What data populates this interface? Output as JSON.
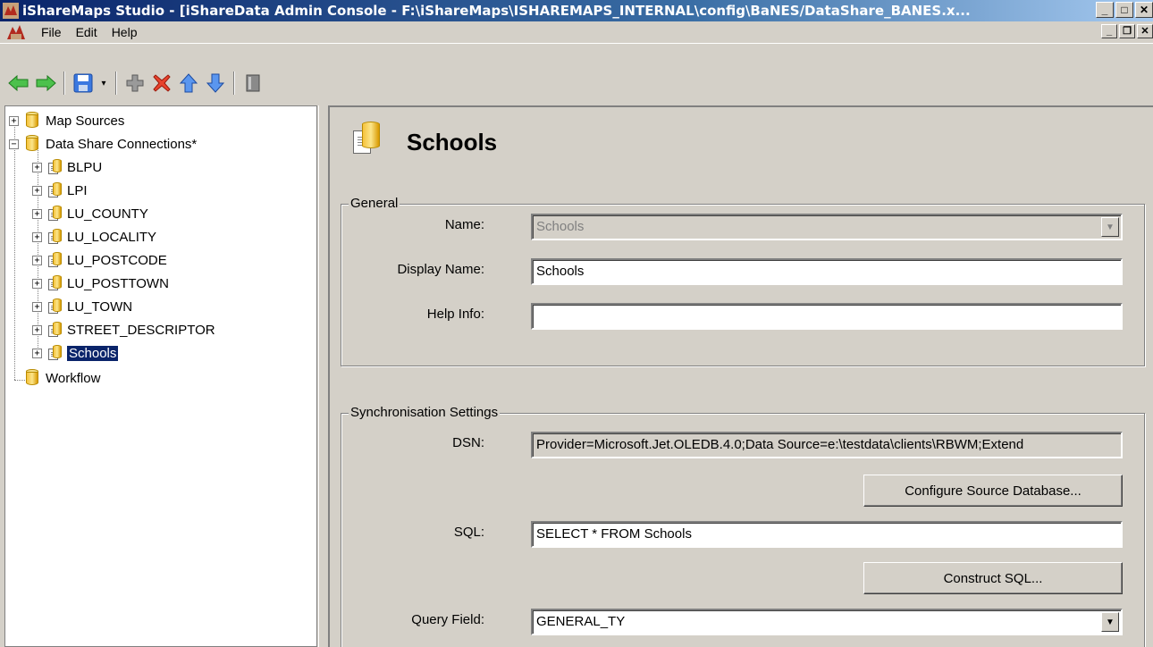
{
  "window": {
    "title": "iShareMaps Studio - [iShareData Admin Console - F:\\iShareMaps\\ISHAREMAPS_INTERNAL\\config\\BaNES/DataShare_BANES.x...",
    "minimize": "_",
    "maximize": "□",
    "close": "✕"
  },
  "menu": {
    "items": [
      "File",
      "Edit",
      "Help"
    ],
    "mdi_minimize": "_",
    "mdi_restore": "❐",
    "mdi_close": "✕"
  },
  "toolbar": {
    "back_icon": "back-arrow-icon",
    "forward_icon": "forward-arrow-icon",
    "save_icon": "save-icon",
    "add_icon": "add-icon",
    "delete_icon": "delete-icon",
    "up_icon": "move-up-icon",
    "down_icon": "move-down-icon",
    "properties_icon": "properties-icon",
    "dropdown_glyph": "▾"
  },
  "tree": {
    "roots": [
      {
        "label": "Map Sources",
        "expander": "+"
      },
      {
        "label": "Data Share Connections*",
        "expander": "−"
      },
      {
        "label": "Workflow",
        "expander": ""
      }
    ],
    "children": [
      {
        "label": "BLPU"
      },
      {
        "label": "LPI"
      },
      {
        "label": "LU_COUNTY"
      },
      {
        "label": "LU_LOCALITY"
      },
      {
        "label": "LU_POSTCODE"
      },
      {
        "label": "LU_POSTTOWN"
      },
      {
        "label": "LU_TOWN"
      },
      {
        "label": "STREET_DESCRIPTOR"
      },
      {
        "label": "Schools"
      }
    ],
    "selected": "Schools"
  },
  "panel": {
    "title": "Schools",
    "general": {
      "legend": "General",
      "name_label": "Name:",
      "name_value": "Schools",
      "display_name_label": "Display Name:",
      "display_name_value": "Schools",
      "help_info_label": "Help Info:",
      "help_info_value": ""
    },
    "sync": {
      "legend": "Synchronisation Settings",
      "dsn_label": "DSN:",
      "dsn_value": "Provider=Microsoft.Jet.OLEDB.4.0;Data Source=e:\\testdata\\clients\\RBWM;Extend",
      "configure_button": "Configure Source Database...",
      "sql_label": "SQL:",
      "sql_value": "SELECT * FROM Schools",
      "construct_button": "Construct SQL...",
      "query_field_label": "Query Field:",
      "query_field_value": "GENERAL_TY"
    }
  },
  "colors": {
    "titlebar_start": "#0a246a",
    "titlebar_end": "#a6caf0",
    "face": "#d4d0c8",
    "selection": "#0a246a",
    "arrow_green": "#2aa52a",
    "arrow_blue": "#3a78e0",
    "delete_red": "#d22a1a"
  }
}
